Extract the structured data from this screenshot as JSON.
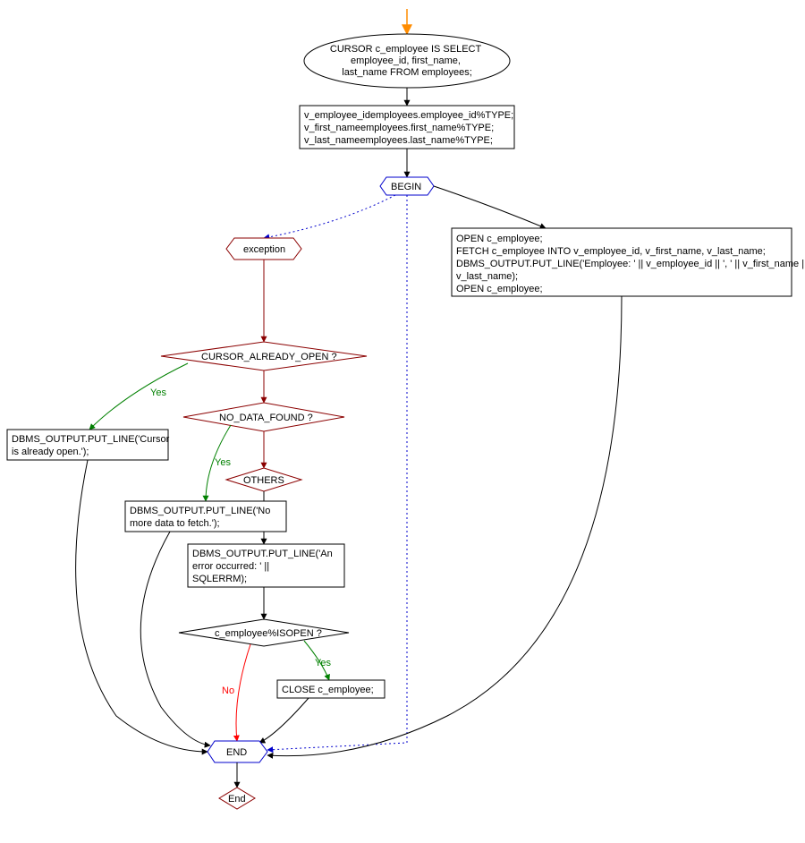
{
  "nodes": {
    "cursor_decl": "CURSOR c_employee IS SELECT\nemployee_id, first_name,\nlast_name FROM employees;",
    "var_decl": "v_employee_idemployees.employee_id%TYPE;\nv_first_nameemployees.first_name%TYPE;\nv_last_nameemployees.last_name%TYPE;",
    "begin": "BEGIN",
    "exception": "exception",
    "open_block": "OPEN c_employee;\nFETCH c_employee INTO v_employee_id, v_first_name, v_last_name;\nDBMS_OUTPUT.PUT_LINE('Employee: ' || v_employee_id || ', ' || v_first_name || ' ' ||\nv_last_name);\nOPEN c_employee;",
    "cursor_open_q": "CURSOR_ALREADY_OPEN ?",
    "no_data_q": "NO_DATA_FOUND ?",
    "others": "OTHERS",
    "put_cursor_open": "DBMS_OUTPUT.PUT_LINE('Cursor\nis already open.');",
    "put_no_more": "DBMS_OUTPUT.PUT_LINE('No\nmore data to fetch.');",
    "put_error": "DBMS_OUTPUT.PUT_LINE('An\nerror occurred: ' ||\nSQLERRM);",
    "isopen_q": "c_employee%ISOPEN ?",
    "close_emp": "CLOSE c_employee;",
    "end": "END",
    "end2": "End"
  },
  "labels": {
    "yes": "Yes",
    "no": "No"
  }
}
